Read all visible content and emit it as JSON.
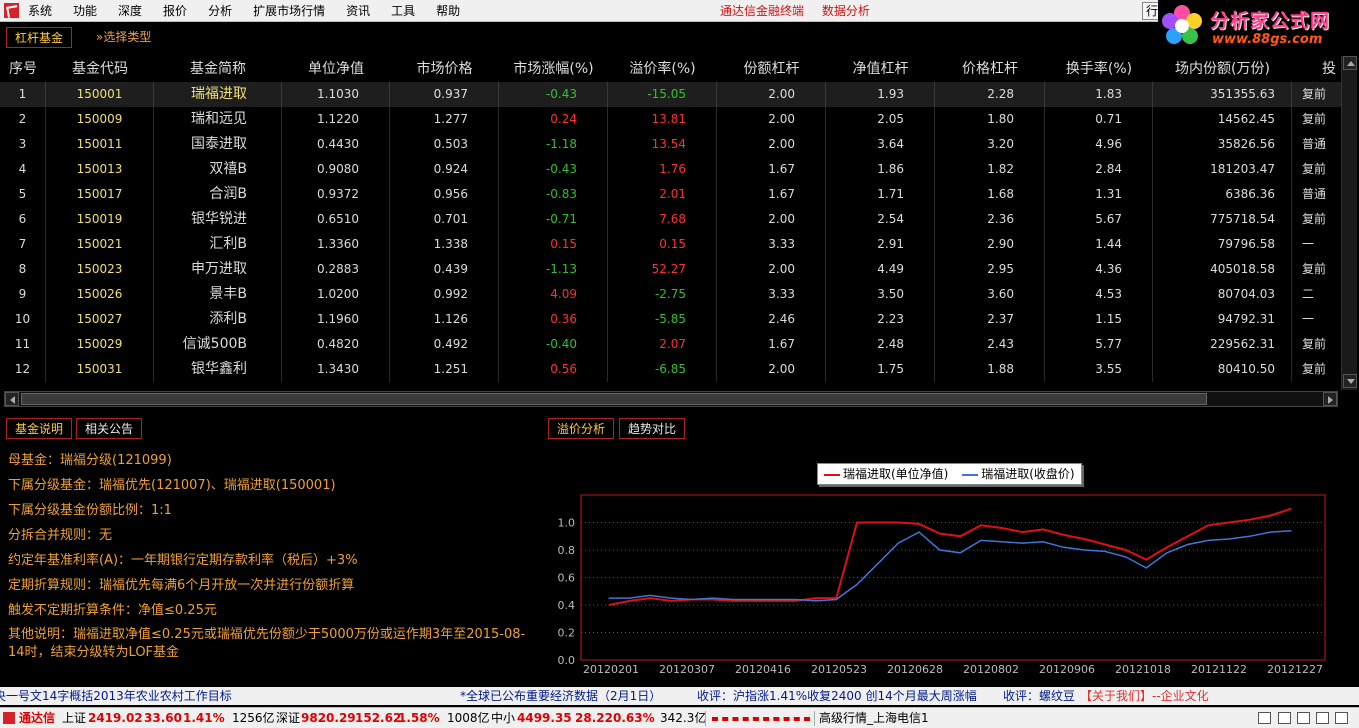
{
  "menubar": {
    "items": [
      "系统",
      "功能",
      "深度",
      "报价",
      "分析",
      "扩展市场行情",
      "资讯",
      "工具",
      "帮助"
    ],
    "center": [
      "通达信金融终端",
      "数据分析"
    ],
    "right_button": "行"
  },
  "brand": {
    "title": "分析家公式网",
    "url": "www.88gs.com"
  },
  "top_tabs": {
    "active": "杠杆基金",
    "select_type": "»选择类型"
  },
  "table": {
    "columns": [
      "序号",
      "基金代码",
      "基金简称",
      "单位净值",
      "市场价格",
      "市场涨幅(%)",
      "溢价率(%)",
      "份额杠杆",
      "净值杠杆",
      "价格杠杆",
      "换手率(%)",
      "场内份额(万份)",
      "投"
    ],
    "rows": [
      {
        "no": "1",
        "code": "150001",
        "name": "瑞福进取",
        "nav": "1.1030",
        "price": "0.937",
        "chg": "-0.43",
        "prem": "-15.05",
        "share_lev": "2.00",
        "nav_lev": "1.93",
        "price_lev": "2.28",
        "turnover": "1.83",
        "shares": "351355.63",
        "type": "复前"
      },
      {
        "no": "2",
        "code": "150009",
        "name": "瑞和远见",
        "nav": "1.1220",
        "price": "1.277",
        "chg": "0.24",
        "prem": "13.81",
        "share_lev": "2.00",
        "nav_lev": "2.05",
        "price_lev": "1.80",
        "turnover": "0.71",
        "shares": "14562.45",
        "type": "复前"
      },
      {
        "no": "3",
        "code": "150011",
        "name": "国泰进取",
        "nav": "0.4430",
        "price": "0.503",
        "chg": "-1.18",
        "prem": "13.54",
        "share_lev": "2.00",
        "nav_lev": "3.64",
        "price_lev": "3.20",
        "turnover": "4.96",
        "shares": "35826.56",
        "type": "普通"
      },
      {
        "no": "4",
        "code": "150013",
        "name": "双禧B",
        "nav": "0.9080",
        "price": "0.924",
        "chg": "-0.43",
        "prem": "1.76",
        "share_lev": "1.67",
        "nav_lev": "1.86",
        "price_lev": "1.82",
        "turnover": "2.84",
        "shares": "181203.47",
        "type": "复前"
      },
      {
        "no": "5",
        "code": "150017",
        "name": "合润B",
        "nav": "0.9372",
        "price": "0.956",
        "chg": "-0.83",
        "prem": "2.01",
        "share_lev": "1.67",
        "nav_lev": "1.71",
        "price_lev": "1.68",
        "turnover": "1.31",
        "shares": "6386.36",
        "type": "普通"
      },
      {
        "no": "6",
        "code": "150019",
        "name": "银华锐进",
        "nav": "0.6510",
        "price": "0.701",
        "chg": "-0.71",
        "prem": "7.68",
        "share_lev": "2.00",
        "nav_lev": "2.54",
        "price_lev": "2.36",
        "turnover": "5.67",
        "shares": "775718.54",
        "type": "复前"
      },
      {
        "no": "7",
        "code": "150021",
        "name": "汇利B",
        "nav": "1.3360",
        "price": "1.338",
        "chg": "0.15",
        "prem": "0.15",
        "share_lev": "3.33",
        "nav_lev": "2.91",
        "price_lev": "2.90",
        "turnover": "1.44",
        "shares": "79796.58",
        "type": "一"
      },
      {
        "no": "8",
        "code": "150023",
        "name": "申万进取",
        "nav": "0.2883",
        "price": "0.439",
        "chg": "-1.13",
        "prem": "52.27",
        "share_lev": "2.00",
        "nav_lev": "4.49",
        "price_lev": "2.95",
        "turnover": "4.36",
        "shares": "405018.58",
        "type": "复前"
      },
      {
        "no": "9",
        "code": "150026",
        "name": "景丰B",
        "nav": "1.0200",
        "price": "0.992",
        "chg": "4.09",
        "prem": "-2.75",
        "share_lev": "3.33",
        "nav_lev": "3.50",
        "price_lev": "3.60",
        "turnover": "4.53",
        "shares": "80704.03",
        "type": "二"
      },
      {
        "no": "10",
        "code": "150027",
        "name": "添利B",
        "nav": "1.1960",
        "price": "1.126",
        "chg": "0.36",
        "prem": "-5.85",
        "share_lev": "2.46",
        "nav_lev": "2.23",
        "price_lev": "2.37",
        "turnover": "1.15",
        "shares": "94792.31",
        "type": "一"
      },
      {
        "no": "11",
        "code": "150029",
        "name": "信诚500B",
        "nav": "0.4820",
        "price": "0.492",
        "chg": "-0.40",
        "prem": "2.07",
        "share_lev": "1.67",
        "nav_lev": "2.48",
        "price_lev": "2.43",
        "turnover": "5.77",
        "shares": "229562.31",
        "type": "复前"
      },
      {
        "no": "12",
        "code": "150031",
        "name": "银华鑫利",
        "nav": "1.3430",
        "price": "1.251",
        "chg": "0.56",
        "prem": "-6.85",
        "share_lev": "2.00",
        "nav_lev": "1.75",
        "price_lev": "1.88",
        "turnover": "3.55",
        "shares": "80410.50",
        "type": "复前"
      }
    ]
  },
  "info_tabs": [
    "基金说明",
    "相关公告"
  ],
  "info": {
    "lines": [
      "母基金：瑞福分级(121099)",
      "下属分级基金：瑞福优先(121007)、瑞福进取(150001)",
      "下属分级基金份额比例：1:1",
      "分拆合并规则：无",
      "约定年基准利率(A)：一年期银行定期存款利率（税后）+3%",
      "定期折算规则：瑞福优先每满6个月开放一次并进行份额折算",
      "触发不定期折算条件：净值≤0.25元",
      "其他说明：瑞福进取净值≤0.25元或瑞福优先份额少于5000万份或运作期3年至2015-08-14时，结束分级转为LOF基金"
    ]
  },
  "chart_tabs": [
    "溢价分析",
    "趋势对比"
  ],
  "chart_data": {
    "type": "line",
    "title": "",
    "xlabel": "",
    "ylabel": "",
    "ylim": [
      0,
      1.2
    ],
    "yticks": [
      "0.0",
      "0.2",
      "0.4",
      "0.6",
      "0.8",
      "1.0"
    ],
    "grid": true,
    "legend_position": "top",
    "x": [
      "20120201",
      "20120307",
      "20120416",
      "20120523",
      "20120628",
      "20120802",
      "20120906",
      "20121018",
      "20121122",
      "20121227"
    ],
    "series": [
      {
        "name": "瑞福进取(单位净值)",
        "color": "#e01010",
        "values": [
          0.4,
          0.43,
          0.45,
          0.43,
          0.44,
          0.44,
          0.43,
          0.43,
          0.43,
          0.43,
          0.45,
          0.45,
          1.0,
          1.0,
          1.0,
          0.99,
          0.92,
          0.9,
          0.98,
          0.96,
          0.93,
          0.95,
          0.91,
          0.88,
          0.84,
          0.8,
          0.73,
          0.82,
          0.9,
          0.98,
          1.0,
          1.02,
          1.05,
          1.1
        ]
      },
      {
        "name": "瑞福进取(收盘价)",
        "color": "#3f76d8",
        "values": [
          0.45,
          0.45,
          0.47,
          0.45,
          0.44,
          0.45,
          0.44,
          0.44,
          0.44,
          0.44,
          0.43,
          0.44,
          0.55,
          0.7,
          0.85,
          0.93,
          0.8,
          0.78,
          0.87,
          0.86,
          0.85,
          0.86,
          0.82,
          0.8,
          0.79,
          0.75,
          0.67,
          0.78,
          0.84,
          0.87,
          0.88,
          0.9,
          0.93,
          0.94
        ]
      }
    ]
  },
  "ticker": {
    "items": [
      "央一号文14字概括2013年农业农村工作目标",
      "*全球已公布重要经济数据（2月1日）",
      "收评：沪指涨1.41%收复2400 创14个月最大周涨幅",
      "收评：螺纹豆",
      "【关于我们】--企业文化"
    ]
  },
  "status": {
    "app": "通达信",
    "sh_label": "上证",
    "sh_val": "2419.02",
    "sh_chg": "33.60",
    "sh_pct": "1.41%",
    "sh_amt": "1256亿",
    "sz_label": "深证",
    "sz_val": "9820.29",
    "sz_chg": "152.62",
    "sz_pct": "1.58%",
    "sz_amt": "1008亿",
    "zx_label": "中小",
    "zx_val": "4499.35",
    "zx_chg": "28.22",
    "zx_pct": "0.63%",
    "zx_amt": "342.3亿",
    "server": "高级行情_上海电信1"
  }
}
